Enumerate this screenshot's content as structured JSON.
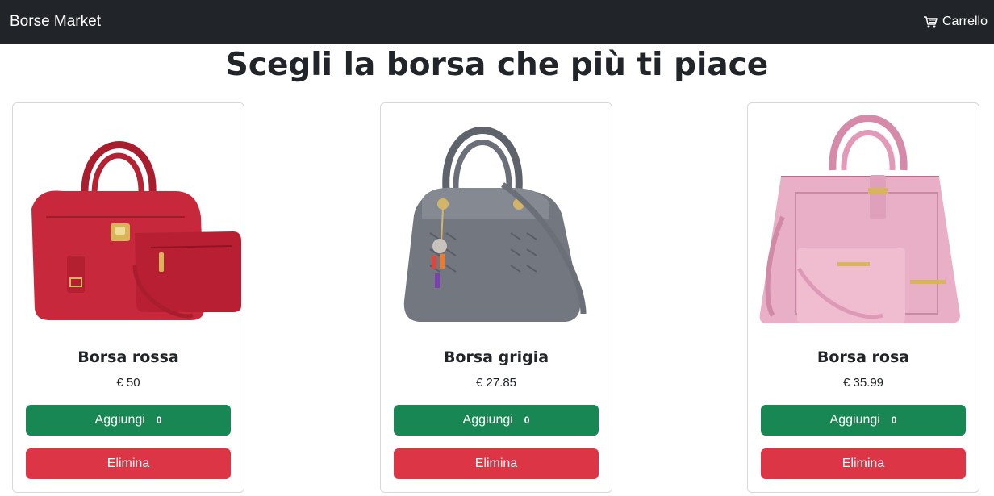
{
  "navbar": {
    "brand": "Borse Market",
    "cart_label": "Carrello",
    "cart_icon": "cart-icon",
    "background": "#212529"
  },
  "page_title": "Scegli la borsa che più ti piace",
  "products": [
    {
      "name": "Borsa rossa",
      "price": "€ 50",
      "add_label": "Aggiungi",
      "count": "0",
      "delete_label": "Elimina",
      "bag_color": "#c8283b"
    },
    {
      "name": "Borsa grigia",
      "price": "€ 27.85",
      "add_label": "Aggiungi",
      "count": "0",
      "delete_label": "Elimina",
      "bag_color": "#737880"
    },
    {
      "name": "Borsa rosa",
      "price": "€ 35.99",
      "add_label": "Aggiungi",
      "count": "0",
      "delete_label": "Elimina",
      "bag_color": "#e9afc6"
    }
  ],
  "colors": {
    "add_button": "#198754",
    "delete_button": "#dc3545"
  }
}
